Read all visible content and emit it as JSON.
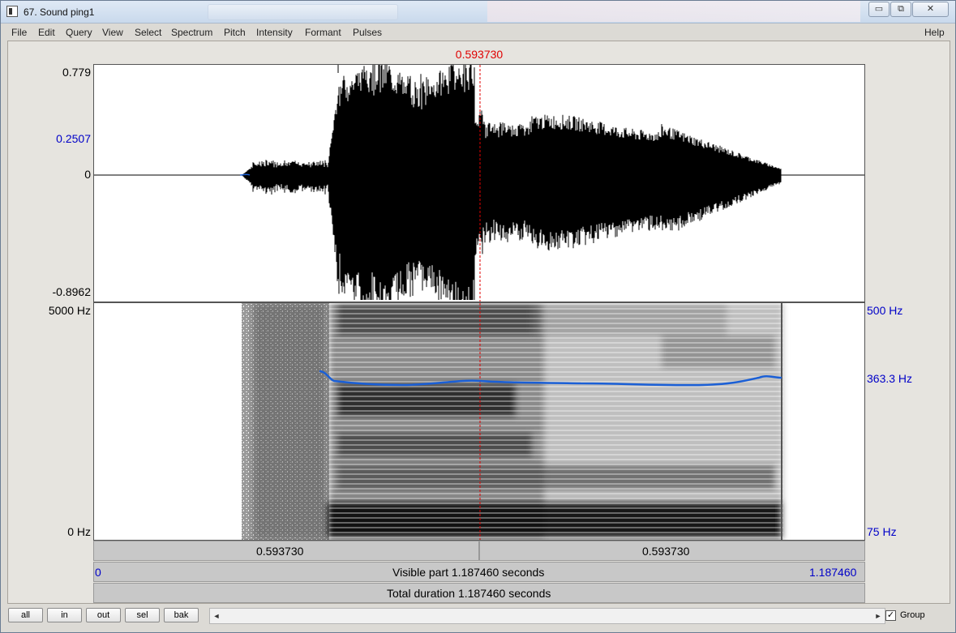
{
  "window": {
    "title": "67. Sound ping1",
    "buttons": {
      "minimize": "▭",
      "restore": "⧉",
      "close": "✕"
    }
  },
  "menu": {
    "items": [
      "File",
      "Edit",
      "Query",
      "View",
      "Select",
      "Spectrum",
      "Pitch",
      "Intensity",
      "Formant",
      "Pulses"
    ],
    "help": "Help"
  },
  "cursor": {
    "time": "0.593730"
  },
  "waveform": {
    "y_max": "0.779",
    "y_cursor": "0.2507",
    "y_zero": "0",
    "y_min": "-0.8962"
  },
  "spectrogram": {
    "freq_top": "5000 Hz",
    "freq_bottom": "0 Hz",
    "pitch_top": "500 Hz",
    "pitch_cursor": "363.3 Hz",
    "pitch_bottom": "75 Hz"
  },
  "time_bars": {
    "left_segment": "0.593730",
    "right_segment": "0.593730",
    "visible_start": "0",
    "visible_part": "Visible part 1.187460 seconds",
    "visible_end": "1.187460",
    "total_duration": "Total duration 1.187460 seconds"
  },
  "buttons": {
    "all": "all",
    "in": "in",
    "out": "out",
    "sel": "sel",
    "bak": "bak"
  },
  "group": {
    "label": "Group",
    "checked": true,
    "check_mark": "✓"
  },
  "scrollbar": {
    "left_arrow": "◄",
    "right_arrow": "►"
  },
  "colors": {
    "cursor": "#e00000",
    "pitch_curve": "#1a5fd6",
    "axis_blue": "#0000c8"
  }
}
